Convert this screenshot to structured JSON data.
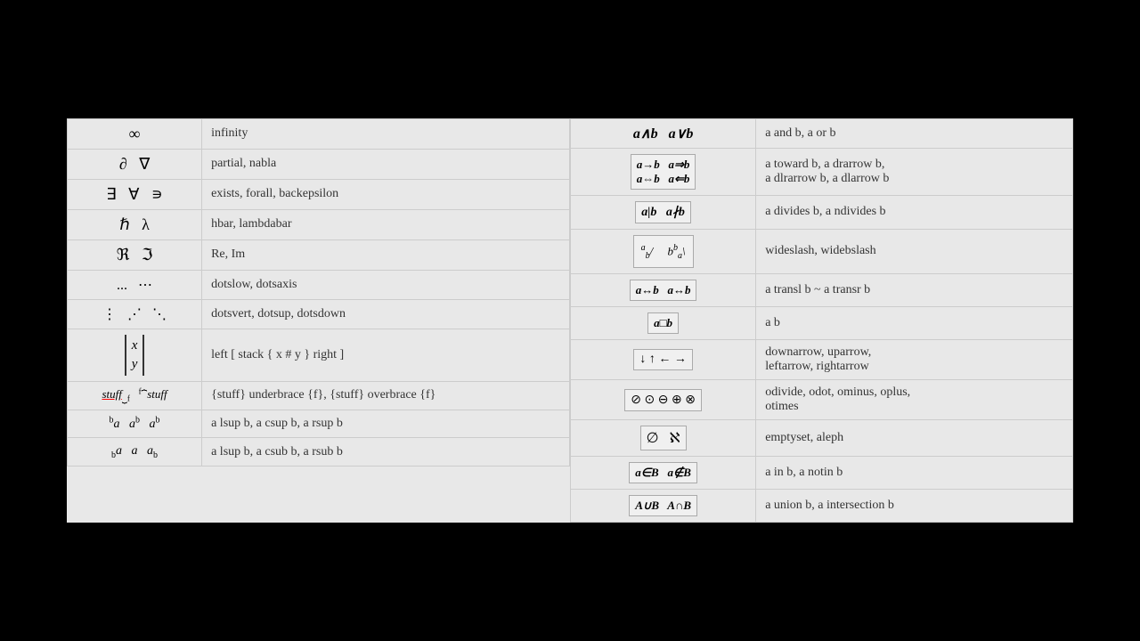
{
  "left_table": {
    "rows": [
      {
        "symbol_html": "<span style='font-size:18px'>∞</span>",
        "desc": "infinity"
      },
      {
        "symbol_html": "<span style='font-size:18px'>∂ &nbsp; ∇</span>",
        "desc": "partial, nabla"
      },
      {
        "symbol_html": "<span style='font-size:18px'>∃ &nbsp; ∀ &nbsp; ∍</span>",
        "desc": "exists, forall, backepsilon"
      },
      {
        "symbol_html": "<span style='font-size:18px'>ℏ &nbsp; λ</span>",
        "desc": "hbar, lambdabar"
      },
      {
        "symbol_html": "<span style='font-size:18px'>ℜ &nbsp; ℑ</span>",
        "desc": "Re, Im"
      },
      {
        "symbol_html": "<span style='font-size:16px'>... &nbsp; ⋯</span>",
        "desc": "dotslow, dotsaxis"
      },
      {
        "symbol_html": "<span style='font-size:16px'>⋮ &nbsp; ⋰ &nbsp; ⋱</span>",
        "desc": "dotsvert, dotsup, dotsdown"
      },
      {
        "symbol_html": "<span class='matrix-sym'><span style='font-style:italic'>x</span><br><span style='font-style:italic'>y</span></span>",
        "desc": "left [ stack { x # y } right ]"
      },
      {
        "symbol_html": "<span class='brace-sym'><u style='text-decoration-color:red'><i>stuff</i></u><sub style='font-size:10px'>⏟</sub><sub style='font-size:9px'>f</sub> &nbsp; <span style='font-size:11px'><sup style='font-size:9px'>f</sup>⏞</span><i>stuff</i></span>",
        "desc": "{stuff} underbrace {f}, {stuff} overbrace {f}"
      },
      {
        "symbol_html": "<span style='font-size:14px'><sup style='font-size:10px'>b</sup><i>a</i> &nbsp; <i>a</i><sup style='font-size:10px'>b</sup> &nbsp; <i>a</i><sup style='font-size:10px'>b</sup></span>",
        "desc": "a lsup b, a csup b, a rsup b"
      },
      {
        "symbol_html": "<span style='font-size:14px'><sub style='font-size:10px'>b</sub><i>a</i> &nbsp; <i>a</i> &nbsp; <i>a</i><sub style='font-size:10px'>b</sub></span>",
        "desc": "a lsup b, a csub b, a rsub b"
      }
    ]
  },
  "right_table": {
    "rows": [
      {
        "symbol_html": "<span style='font-size:16px; font-style:italic; font-weight:bold'>a∧b &nbsp; a∨b</span>",
        "desc": "a and b, a or b"
      },
      {
        "symbol_html": "<span class='symbol-box' style='font-size:13px; font-style:italic'><b>a→b &nbsp; a⇒b</b><br><b>a⇔b &nbsp; a⇐b</b></span>",
        "desc": "a toward b, a drarrow b,\na dlrarrow b, a dlarrow b"
      },
      {
        "symbol_html": "<span class='symbol-box' style='font-size:14px; font-style:italic'><b>a|b &nbsp; a∤b</b></span>",
        "desc": "a divides b, a ndivides b"
      },
      {
        "symbol_html": "<span class='symbol-box' style='font-size:13px; font-style:italic; padding:8px'><sup style='font-size:10px'>a</sup><sub style='font-size:10px'>b</sub>/ &nbsp; &nbsp; b<sup style='font-size:10px'>b</sup><sub style='font-size:10px'>a</sub>\\</span>",
        "desc": "wideslash, widebslash"
      },
      {
        "symbol_html": "<span class='symbol-box' style='font-size:13px; font-style:italic'><b>a↔b &nbsp; a↔b</b></span>",
        "desc": "a transl b ~ a transr b"
      },
      {
        "symbol_html": "<span class='symbol-box' style='font-size:13px; font-style:italic'><b>a□b</b></span>",
        "desc": "a <?> b"
      },
      {
        "symbol_html": "<span class='symbol-box' style='font-size:14px'>↓ ↑ ← →</span>",
        "desc": "downarrow, uparrow,\nleftarrow, rightarrow"
      },
      {
        "symbol_html": "<span class='symbol-box' style='font-size:14px'>⊘ ⊙ ⊖ ⊕ ⊗</span>",
        "desc": "odivide, odot, ominus, oplus,\notimes"
      },
      {
        "symbol_html": "<span class='symbol-box' style='font-size:16px'>∅ &nbsp; ℵ</span>",
        "desc": "emptyset, aleph"
      },
      {
        "symbol_html": "<span class='symbol-box' style='font-size:13px; font-style:italic'><b>a∈B &nbsp; a∉B</b></span>",
        "desc": "a in b, a notin b"
      },
      {
        "symbol_html": "<span class='symbol-box' style='font-size:13px; font-style:italic'><b>A∪B &nbsp; A∩B</b></span>",
        "desc": "a union b, a intersection b"
      }
    ]
  }
}
